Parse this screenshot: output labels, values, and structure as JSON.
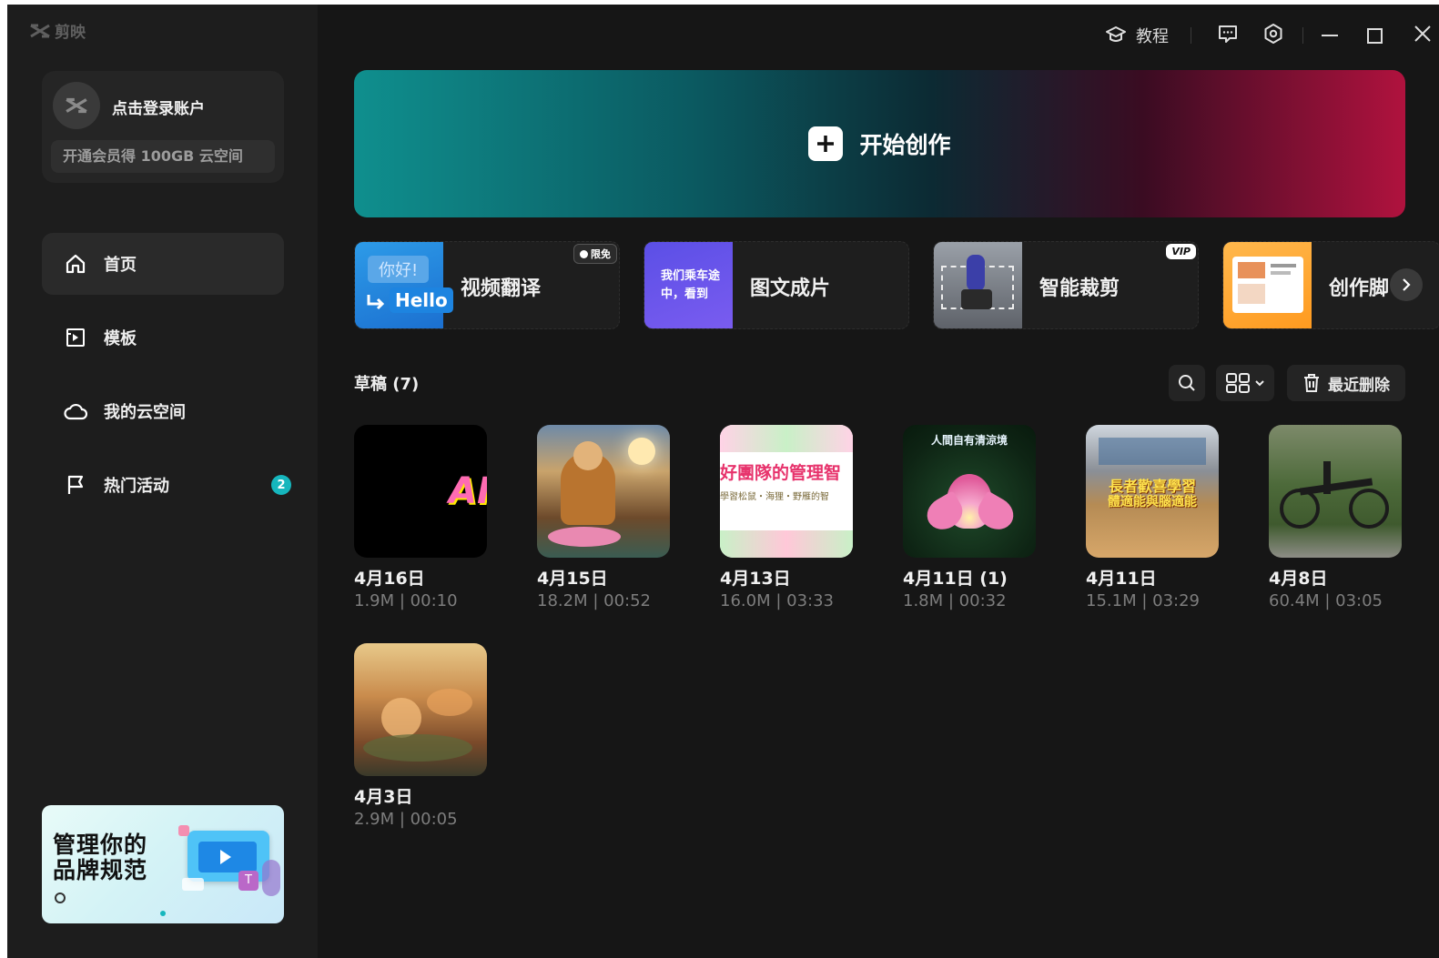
{
  "app": {
    "name": "剪映"
  },
  "account": {
    "login_label": "点击登录账户",
    "promo": "开通会员得 100GB 云空间"
  },
  "nav": [
    {
      "label": "首页",
      "icon": "home-icon",
      "active": true
    },
    {
      "label": "模板",
      "icon": "template-icon",
      "active": false
    },
    {
      "label": "我的云空间",
      "icon": "cloud-icon",
      "active": false
    },
    {
      "label": "热门活动",
      "icon": "flag-icon",
      "active": false,
      "badge": "2"
    }
  ],
  "promo_banner": {
    "line1": "管理你的",
    "line2": "品牌规范"
  },
  "topbar": {
    "tutorial": "教程"
  },
  "hero": {
    "label": "开始创作"
  },
  "tools": [
    {
      "label": "视频翻译",
      "tag": "限免",
      "thumb_text1": "你好!",
      "thumb_text2": "Hello"
    },
    {
      "label": "图文成片",
      "thumb_text1": "我们乘车途",
      "thumb_text2": "中，看到"
    },
    {
      "label": "智能裁剪",
      "tag": "VIP"
    },
    {
      "label": "创作脚"
    }
  ],
  "drafts": {
    "title": "草稿 (7)",
    "recent_delete": "最近删除",
    "items": [
      {
        "date": "4月16日",
        "meta": "1.9M | 00:10",
        "thumb_text": "AI"
      },
      {
        "date": "4月15日",
        "meta": "18.2M | 00:52"
      },
      {
        "date": "4月13日",
        "meta": "16.0M | 03:33",
        "thumb_text": "好團隊的管理智",
        "thumb_sub": "學習松鼠・海狸・野雁的智"
      },
      {
        "date": "4月11日 (1)",
        "meta": "1.8M | 00:32",
        "thumb_text": "人間自有清涼境"
      },
      {
        "date": "4月11日",
        "meta": "15.1M | 03:29",
        "thumb_text": "長者歡喜學習",
        "thumb_sub": "體適能與腦適能"
      },
      {
        "date": "4月8日",
        "meta": "60.4M | 03:05"
      },
      {
        "date": "4月3日",
        "meta": "2.9M | 00:05"
      }
    ]
  },
  "colors": {
    "accent": "#16b6bd",
    "hero_left": "#0f8f8e",
    "hero_right": "#b0123e"
  }
}
